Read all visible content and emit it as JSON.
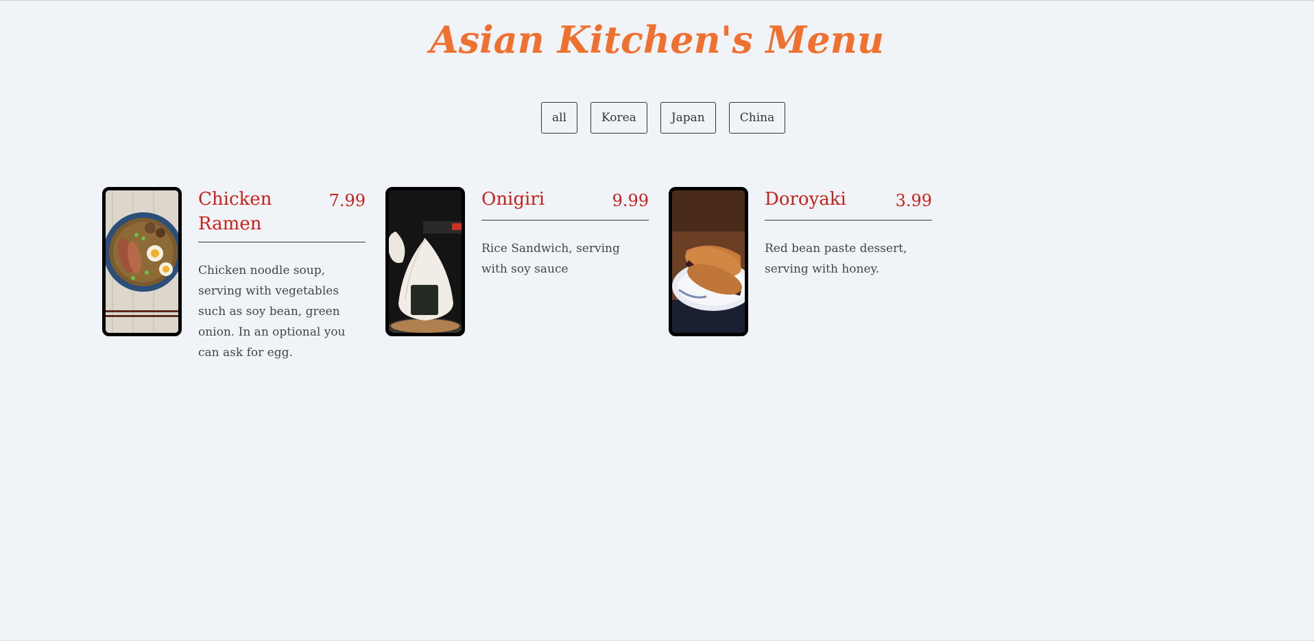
{
  "page": {
    "title": "Asian Kitchen's Menu"
  },
  "filters": [
    {
      "label": "all"
    },
    {
      "label": "Korea"
    },
    {
      "label": "Japan"
    },
    {
      "label": "China"
    }
  ],
  "menu": {
    "items": [
      {
        "name": "Chicken Ramen",
        "price": "7.99",
        "description": "Chicken noodle soup, serving with vegetables such as soy bean, green onion. In an optional you can ask for egg."
      },
      {
        "name": "Onigiri",
        "price": "9.99",
        "description": "Rice Sandwich, serving with soy sauce"
      },
      {
        "name": "Doroyaki",
        "price": "3.99",
        "description": "Red bean paste dessert, serving with honey."
      }
    ]
  },
  "colors": {
    "accent_title": "#f07030",
    "item_text": "#c8211a",
    "background": "#f0f4f8"
  }
}
